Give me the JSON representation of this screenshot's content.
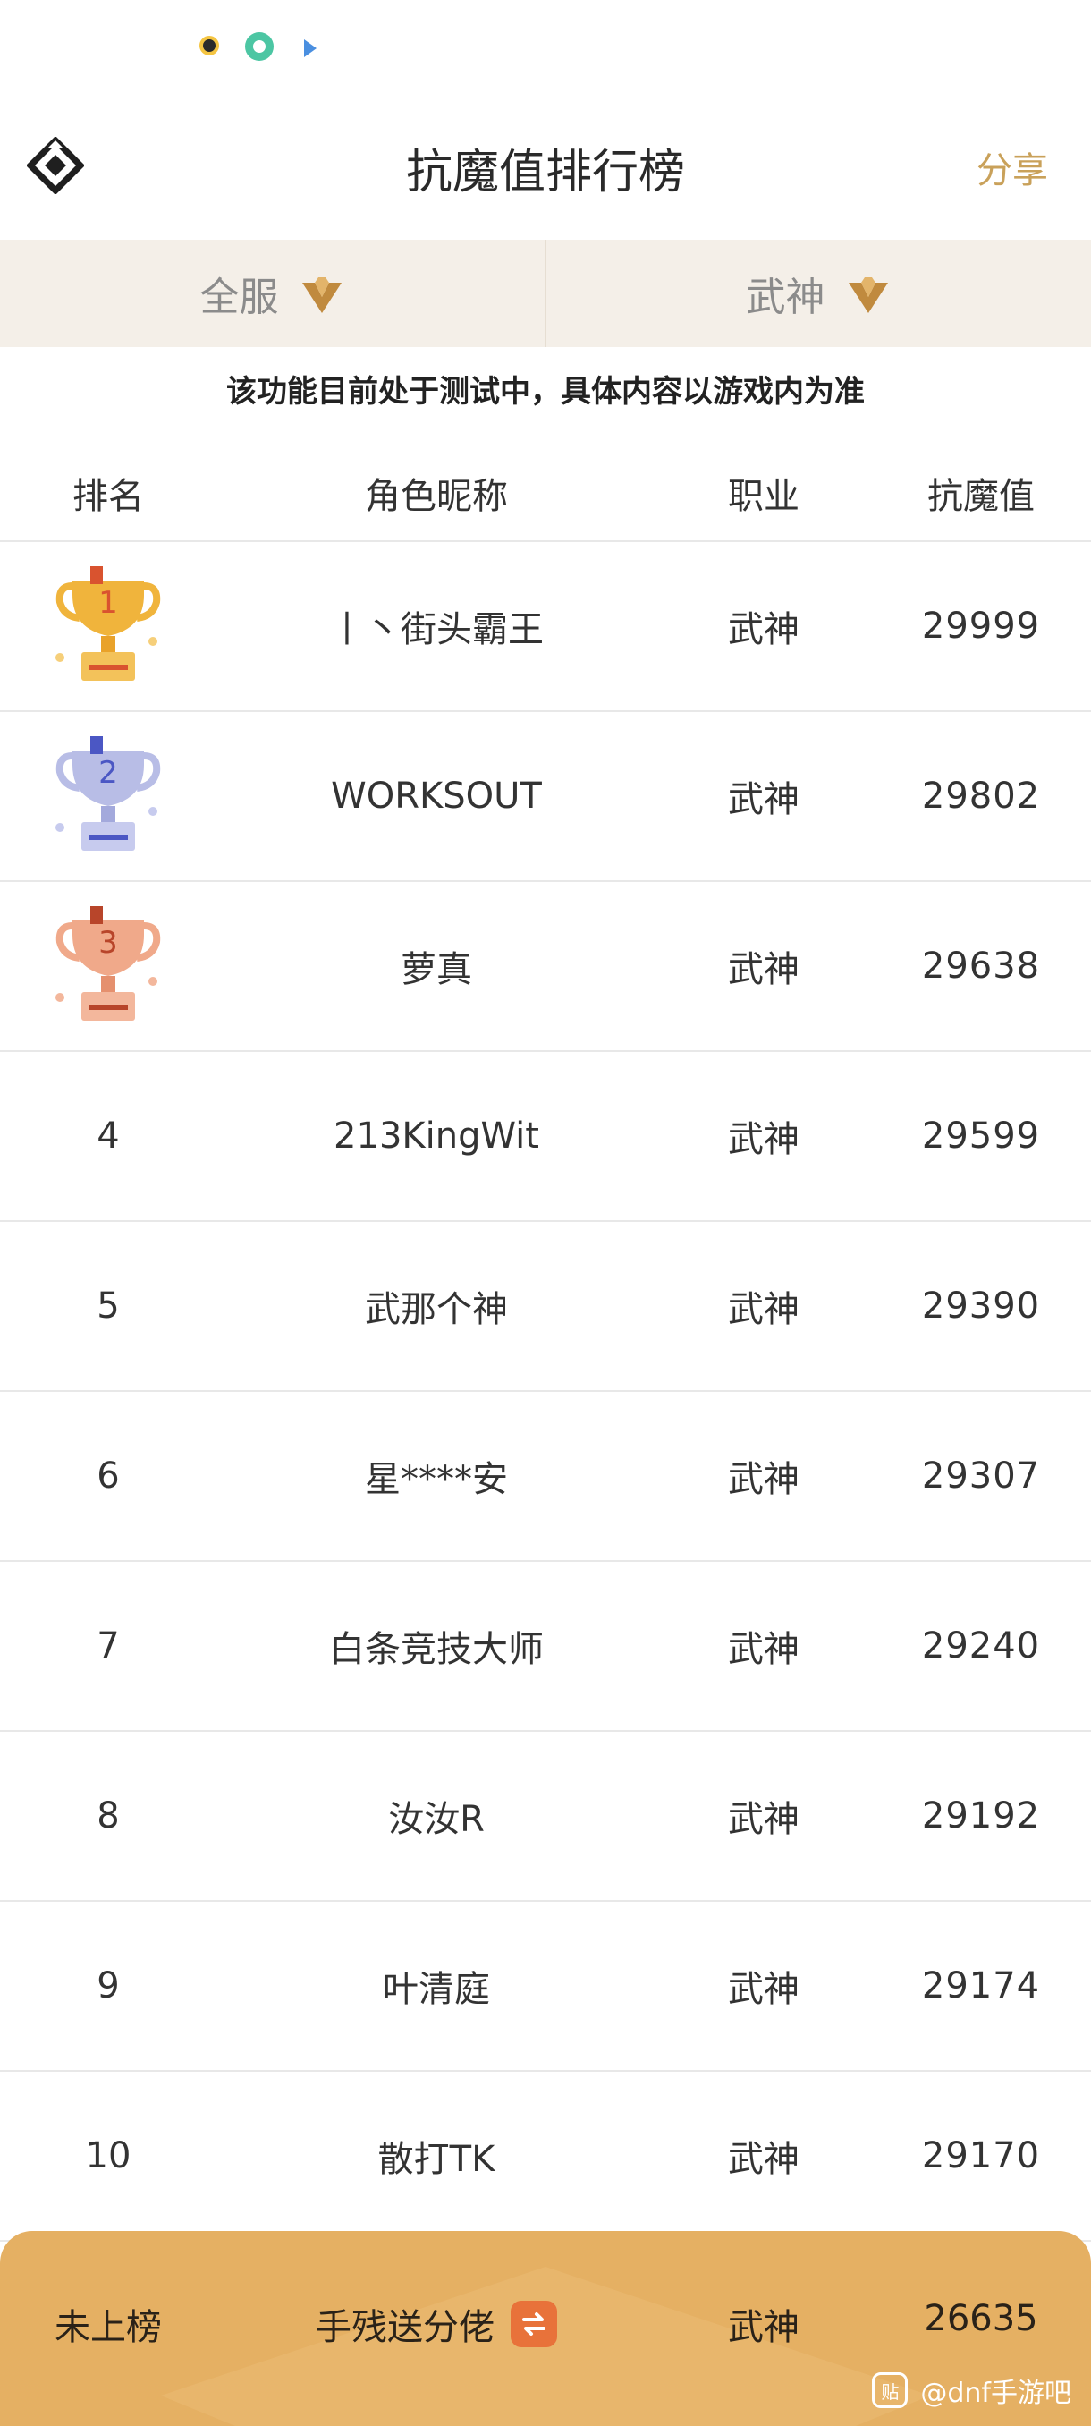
{
  "header": {
    "title": "抗魔值排行榜",
    "share_label": "分享"
  },
  "filters": [
    {
      "label": "全服"
    },
    {
      "label": "武神"
    }
  ],
  "notice": "该功能目前处于测试中，具体内容以游戏内为准",
  "table": {
    "columns": {
      "rank": "排名",
      "name": "角色昵称",
      "job": "职业",
      "score": "抗魔值"
    },
    "rows": [
      {
        "rank": "1",
        "name": "丨丶街头霸王",
        "job": "武神",
        "score": "29999"
      },
      {
        "rank": "2",
        "name": "WORKSOUT",
        "job": "武神",
        "score": "29802"
      },
      {
        "rank": "3",
        "name": "萝真",
        "job": "武神",
        "score": "29638"
      },
      {
        "rank": "4",
        "name": "213KingWit",
        "job": "武神",
        "score": "29599"
      },
      {
        "rank": "5",
        "name": "武那个神",
        "job": "武神",
        "score": "29390"
      },
      {
        "rank": "6",
        "name": "星****安",
        "job": "武神",
        "score": "29307"
      },
      {
        "rank": "7",
        "name": "白条竞技大师",
        "job": "武神",
        "score": "29240"
      },
      {
        "rank": "8",
        "name": "汝汝R",
        "job": "武神",
        "score": "29192"
      },
      {
        "rank": "9",
        "name": "叶清庭",
        "job": "武神",
        "score": "29174"
      },
      {
        "rank": "10",
        "name": "散打TK",
        "job": "武神",
        "score": "29170"
      }
    ]
  },
  "my_rank": {
    "rank": "未上榜",
    "name": "手残送分佬",
    "job": "武神",
    "score": "26635"
  },
  "watermark": {
    "icon_text": "贴",
    "text": "@dnf手游吧"
  },
  "colors": {
    "accent_gold": "#c9a15a",
    "footer_bg": "#e5b063",
    "filter_bg": "#f4efe8",
    "gold_trophy": "#f0b43c",
    "silver_trophy": "#b8bde6",
    "bronze_trophy": "#f0a98a"
  },
  "icons": {
    "logo": "diamond-logo-icon",
    "filter_arrow": "chevron-down-icon",
    "trophies": [
      "gold-trophy-icon",
      "silver-trophy-icon",
      "bronze-trophy-icon"
    ],
    "switch": "swap-icon"
  }
}
